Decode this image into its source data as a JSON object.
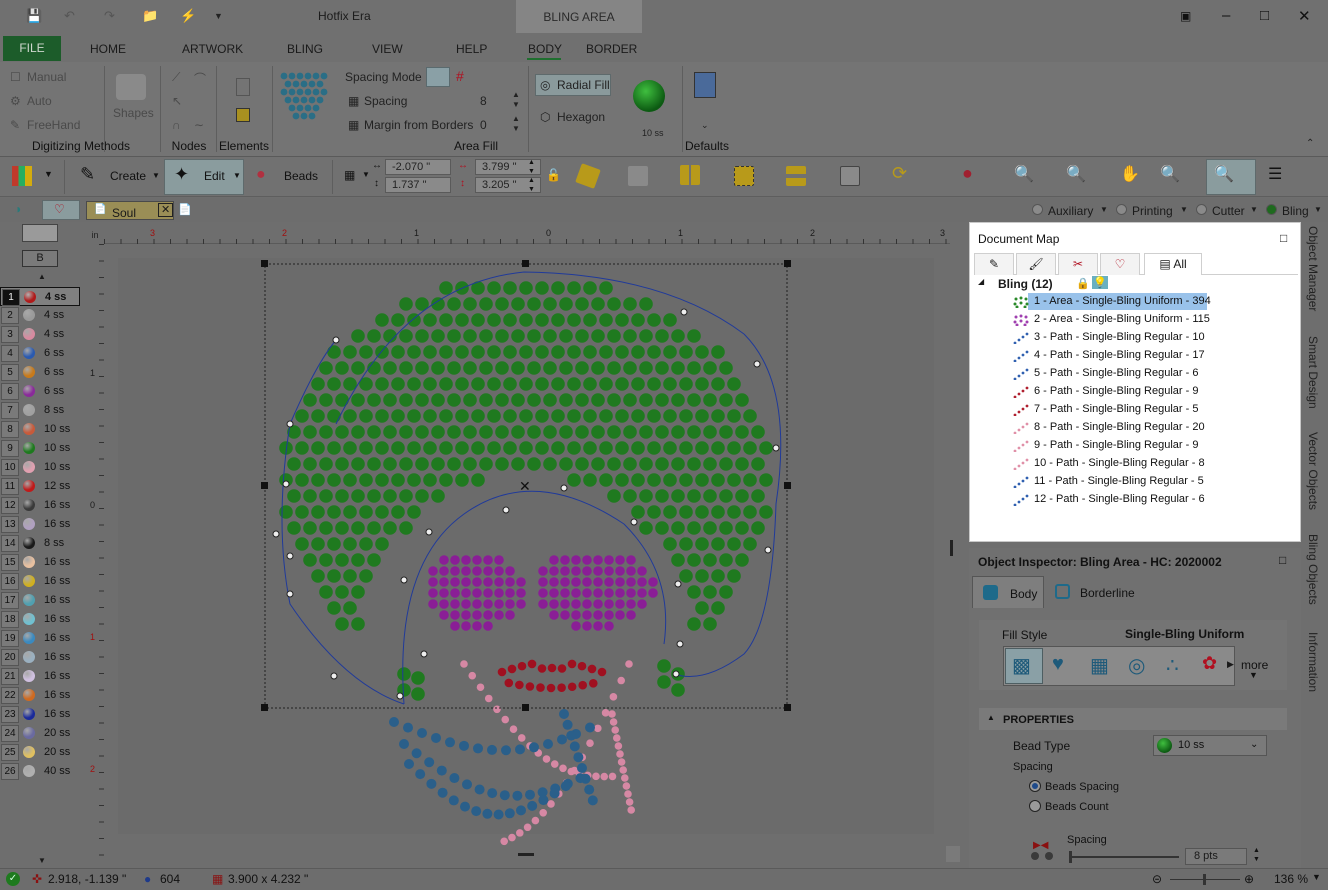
{
  "app": {
    "title": "Hotfix Era",
    "context_tab": "BLING AREA"
  },
  "tabs": [
    "FILE",
    "HOME",
    "ARTWORK",
    "BLING",
    "VIEW",
    "HELP",
    "BODY",
    "BORDER"
  ],
  "ribbon": {
    "digitizing": {
      "manual": "Manual",
      "auto": "Auto",
      "freehand": "FreeHand",
      "label": "Digitizing Methods"
    },
    "shapes": "Shapes",
    "nodes": "Nodes",
    "elements": "Elements",
    "area_fill": {
      "spacing_mode": "Spacing Mode",
      "spacing": "Spacing",
      "spacing_value": "8",
      "margin": "Margin from Borders",
      "margin_value": "0",
      "label": "Area Fill"
    },
    "fill_types": {
      "radial": "Radial Fill",
      "hexagon": "Hexagon"
    },
    "bead_size": "10 ss",
    "defaults": "Defaults"
  },
  "toolbar": {
    "create": "Create",
    "edit": "Edit",
    "beads": "Beads",
    "x": "-2.070 \"",
    "y": "1.737 \"",
    "w": "3.799 \"",
    "h": "3.205 \""
  },
  "row2": {
    "doc_tab": "Soul",
    "auxiliary": "Auxiliary",
    "printing": "Printing",
    "cutter": "Cutter",
    "bling": "Bling",
    "b_label": "B"
  },
  "swatches": [
    {
      "n": "1",
      "size": "4 ss",
      "color": "#b01a1a"
    },
    {
      "n": "2",
      "size": "4 ss",
      "color": "#9a9a9a"
    },
    {
      "n": "3",
      "size": "4 ss",
      "color": "#d88aa0"
    },
    {
      "n": "4",
      "size": "6 ss",
      "color": "#2a5ab0"
    },
    {
      "n": "5",
      "size": "6 ss",
      "color": "#c87a1a"
    },
    {
      "n": "6",
      "size": "6 ss",
      "color": "#8a2a9a"
    },
    {
      "n": "7",
      "size": "8 ss",
      "color": "#a0a0a0"
    },
    {
      "n": "8",
      "size": "10 ss",
      "color": "#c85a3a"
    },
    {
      "n": "9",
      "size": "10 ss",
      "color": "#1e7a1e"
    },
    {
      "n": "10",
      "size": "10 ss",
      "color": "#e0a0b0"
    },
    {
      "n": "11",
      "size": "12 ss",
      "color": "#c01a1a"
    },
    {
      "n": "12",
      "size": "16 ss",
      "color": "#3a3a3a"
    },
    {
      "n": "13",
      "size": "16 ss",
      "color": "#b0a0c0"
    },
    {
      "n": "14",
      "size": "8 ss",
      "color": "#1a1a1a"
    },
    {
      "n": "15",
      "size": "16 ss",
      "color": "#e8c0a0"
    },
    {
      "n": "16",
      "size": "16 ss",
      "color": "#d0b020"
    },
    {
      "n": "17",
      "size": "16 ss",
      "color": "#50a0b0"
    },
    {
      "n": "18",
      "size": "16 ss",
      "color": "#70c0d0"
    },
    {
      "n": "19",
      "size": "16 ss",
      "color": "#3a8ac0"
    },
    {
      "n": "20",
      "size": "16 ss",
      "color": "#9ab0c0"
    },
    {
      "n": "21",
      "size": "16 ss",
      "color": "#d0c0e0"
    },
    {
      "n": "22",
      "size": "16 ss",
      "color": "#d06a20"
    },
    {
      "n": "23",
      "size": "16 ss",
      "color": "#1a2a9a"
    },
    {
      "n": "24",
      "size": "20 ss",
      "color": "#6a6aa0"
    },
    {
      "n": "25",
      "size": "20 ss",
      "color": "#e0c060"
    },
    {
      "n": "26",
      "size": "40 ss",
      "color": "#b0b0b0"
    }
  ],
  "rulers": {
    "top": [
      "3",
      "2",
      "1",
      "0",
      "1",
      "2",
      "3"
    ],
    "left": [
      "1",
      "0",
      "1",
      "2"
    ],
    "corner": "in"
  },
  "document_map": {
    "title": "Document Map",
    "tab_all": "All",
    "root": "Bling (12)",
    "items": [
      {
        "label": "1 - Area - Single-Bling Uniform - 394",
        "color": "#2a8a2a"
      },
      {
        "label": "2 - Area - Single-Bling Uniform - 115",
        "color": "#a040b0"
      },
      {
        "label": "3 - Path - Single-Bling Regular - 10",
        "color": "#3060b0"
      },
      {
        "label": "4 - Path - Single-Bling Regular - 17",
        "color": "#3060b0"
      },
      {
        "label": "5 - Path - Single-Bling Regular - 6",
        "color": "#3060b0"
      },
      {
        "label": "6 - Path - Single-Bling Regular - 9",
        "color": "#b02030"
      },
      {
        "label": "7 - Path - Single-Bling Regular - 5",
        "color": "#b02030"
      },
      {
        "label": "8 - Path - Single-Bling Regular - 20",
        "color": "#e090a8"
      },
      {
        "label": "9 - Path - Single-Bling Regular - 9",
        "color": "#e090a8"
      },
      {
        "label": "10 - Path - Single-Bling Regular - 8",
        "color": "#e090a8"
      },
      {
        "label": "11 - Path - Single-Bling Regular - 5",
        "color": "#3060b0"
      },
      {
        "label": "12 - Path - Single-Bling Regular - 6",
        "color": "#3060b0"
      }
    ]
  },
  "inspector": {
    "title": "Object Inspector: Bling Area - HC: 2020002",
    "tab_body": "Body",
    "tab_border": "Borderline",
    "fill_style": "Fill Style",
    "fill_style_value": "Single-Bling Uniform",
    "more": "more",
    "properties": "PROPERTIES",
    "bead_type": "Bead Type",
    "bead_type_value": "10 ss",
    "spacing": "Spacing",
    "beads_spacing": "Beads Spacing",
    "beads_count": "Beads Count",
    "spacing2": "Spacing",
    "spacing_value": "8 pts"
  },
  "right_tabs": [
    "Object Manager",
    "Smart Design",
    "Vector Objects",
    "Bling Objects",
    "Information"
  ],
  "status": {
    "coords": "2.918, -1.139 \"",
    "count": "604",
    "size": "3.900 x 4.232 \"",
    "zoom": "136 %"
  }
}
